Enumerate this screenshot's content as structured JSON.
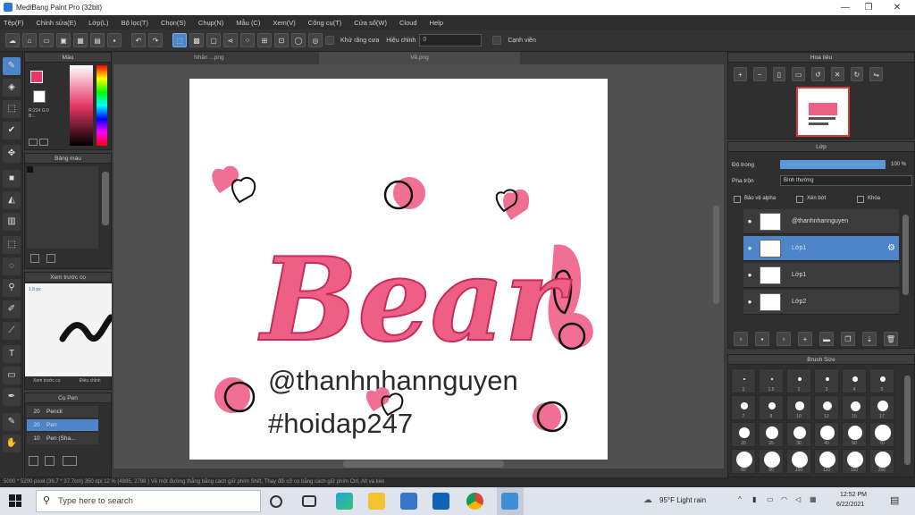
{
  "window": {
    "title": "MediBang Paint Pro (32bit)"
  },
  "menu": [
    "Tệp(F)",
    "Chỉnh sửa(E)",
    "Lớp(L)",
    "Bộ lọc(T)",
    "Chọn(S)",
    "Chụp(N)",
    "Mẫu (C)",
    "Xem(V)",
    "Công cụ(T)",
    "Cửa sổ(W)",
    "Cloud",
    "Help"
  ],
  "toolbar": {
    "auto_fill": "Khử răng cưa",
    "correction_label": "Hiệu chỉnh",
    "correction_value": "0",
    "edge_label": "Cạnh viền"
  },
  "tabs": {
    "left": "Nhân ...png",
    "right": "Vẽ.png"
  },
  "panels": {
    "color": "Màu",
    "color_rgb": "R:224 G:0 B:..",
    "palette": "Bảng màu",
    "brush_preview": "Xem trước cọ",
    "brush_preview_size": "1.8 px",
    "brush_tab_1": "Xem trước cọ",
    "brush_tab_2": "Điều chỉnh",
    "brush_list_title": "Cọ Pen",
    "navigator": "Hoa tiêu",
    "layer": "Lớp",
    "opacity_label": "Độ trong",
    "opacity_value": "100 %",
    "blend_label": "Pha trộn",
    "blend_value": "Bình thường",
    "lock_alpha": "Bảo vệ alpha",
    "clipping": "Xén bớt",
    "lock": "Khóa",
    "brush_size": "Brush Size"
  },
  "brushes": [
    {
      "size": "20",
      "name": "Pencil"
    },
    {
      "size": "20",
      "name": "Pen"
    },
    {
      "size": "10",
      "name": "Pen (Sha..."
    }
  ],
  "brush_size_cells": [
    {
      "label": "1"
    },
    {
      "label": "1.5"
    },
    {
      "label": "2"
    },
    {
      "label": "3"
    },
    {
      "label": "4"
    },
    {
      "label": "5"
    },
    {
      "label": "7"
    },
    {
      "label": "8"
    },
    {
      "label": "10"
    },
    {
      "label": "12"
    },
    {
      "label": "15"
    },
    {
      "label": "17"
    },
    {
      "label": "20"
    },
    {
      "label": "25"
    },
    {
      "label": "30"
    },
    {
      "label": "40"
    },
    {
      "label": "50"
    },
    {
      "label": "70"
    },
    {
      "label": "80"
    },
    {
      "label": "90"
    },
    {
      "label": "100"
    },
    {
      "label": "120"
    },
    {
      "label": "150"
    },
    {
      "label": "200"
    }
  ],
  "layers": [
    {
      "name": "@thanhnhannguyen",
      "selected": false
    },
    {
      "name": "Lớp1",
      "selected": true
    },
    {
      "name": "Lớp1",
      "selected": false
    },
    {
      "name": "Lớp2",
      "selected": false
    }
  ],
  "artwork": {
    "word": "Bear",
    "handle": "@thanhnhannguyen",
    "hashtag": "#hoidap247"
  },
  "status": "5000 * 5200 pixel  (36.7 * 37.7cm)  350 dpi  12 %  (4885, 2798 )  Vẽ một đường thẳng bằng cách giữ phím Shift, Thay đổi cỡ cọ bằng cách giữ phím Ctrl, Alt và kéo",
  "taskbar": {
    "search_placeholder": "Type here to search",
    "weather": "95°F  Light rain",
    "time": "12:52 PM",
    "date": "6/22/2021"
  },
  "colors": {
    "accent": "#4d86c8",
    "pink": "#f06f93",
    "deep_pink": "#e63865"
  }
}
